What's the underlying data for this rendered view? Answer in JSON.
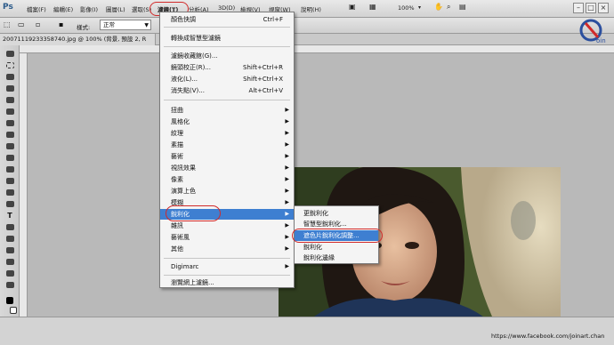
{
  "app": {
    "logo_text": "Ps"
  },
  "menubar": {
    "items": [
      "檔案(F)",
      "編輯(E)",
      "影像(I)",
      "圖層(L)",
      "選取(S)",
      "濾鏡(T)",
      "分析(A)",
      "3D(D)",
      "檢視(V)",
      "視窗(W)",
      "說明(H)"
    ],
    "zoom": "100%"
  },
  "options": {
    "style_label": "樣式:",
    "style_value": "正常"
  },
  "document": {
    "tab_title": "20071119233358740.jpg @ 100% (背景, 預設 2, R"
  },
  "filter_menu": {
    "items": [
      {
        "label": "顏色快調",
        "shortcut": "Ctrl+F"
      },
      {
        "label": "轉換成智慧型濾鏡"
      },
      {
        "label": "濾鏡收藏館(G)..."
      },
      {
        "label": "鏡頭校正(R)...",
        "shortcut": "Shift+Ctrl+R"
      },
      {
        "label": "液化(L)...",
        "shortcut": "Shift+Ctrl+X"
      },
      {
        "label": "消失點(V)...",
        "shortcut": "Alt+Ctrl+V"
      },
      {
        "label": "扭曲"
      },
      {
        "label": "風格化"
      },
      {
        "label": "紋理"
      },
      {
        "label": "素描"
      },
      {
        "label": "藝術"
      },
      {
        "label": "視訊效果"
      },
      {
        "label": "像素"
      },
      {
        "label": "演算上色"
      },
      {
        "label": "模糊"
      },
      {
        "label": "銳利化"
      },
      {
        "label": "雜訊"
      },
      {
        "label": "藝術風"
      },
      {
        "label": "其他"
      },
      {
        "label": "Digimarc"
      },
      {
        "label": "瀏覽網上濾鏡..."
      }
    ]
  },
  "sharpen_submenu": {
    "items": [
      "更銳利化",
      "智慧型銳利化...",
      "遮色片銳利化調整...",
      "銳利化",
      "銳利化邊緣"
    ]
  },
  "status": {
    "url": "https://www.facebook.com/joinart.chan"
  },
  "colors": {
    "highlight": "#3e7fd1",
    "annotation": "#d12a2a"
  }
}
